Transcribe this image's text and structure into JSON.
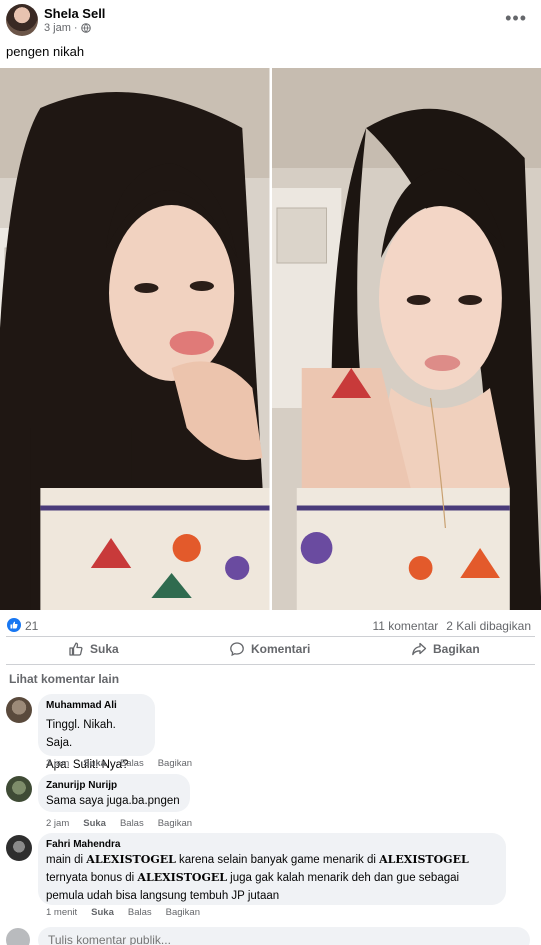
{
  "post": {
    "author": "Shela Sell",
    "time": "3 jam",
    "dot": "·",
    "caption": "pengen nikah"
  },
  "stats": {
    "likes": "21",
    "comments": "11 komentar",
    "shares": "2 Kali dibagikan"
  },
  "actions": {
    "like": "Suka",
    "comment": "Komentari",
    "share": "Bagikan"
  },
  "more_comments": "Lihat komentar lain",
  "comments": [
    {
      "name": "Muhammad Ali",
      "line1": "Tinggl. Nikah. Saja.",
      "line2": "Apa. Sulit. Nya?",
      "time": "3 jam",
      "like": "Suka",
      "reply": "Balas",
      "share": "Bagikan"
    },
    {
      "name": "Zanurijp Nurijp",
      "line1": "Sama saya juga.ba.pngen",
      "time": "2 jam",
      "like": "Suka",
      "reply": "Balas",
      "share": "Bagikan"
    },
    {
      "name": "Fahri Mahendra",
      "t1": "main di ",
      "brand1": "ALEXISTOGEL",
      "t2": " karena selain banyak game menarik di ",
      "brand2": "ALEXISTOGEL",
      "t3": "ternyata bonus di ",
      "brand3": "ALEXISTOGEL",
      "t4": " juga gak kalah menarik deh dan gue sebagai",
      "t5": "pemula udah bisa langsung tembuh JP jutaan",
      "time": "1 menit",
      "like": "Suka",
      "reply": "Balas",
      "share": "Bagikan"
    }
  ],
  "input": {
    "placeholder": "Tulis komentar publik..."
  },
  "colors": {
    "accent": "#1877f2",
    "muted": "#65676b",
    "bubble": "#f0f2f5"
  }
}
